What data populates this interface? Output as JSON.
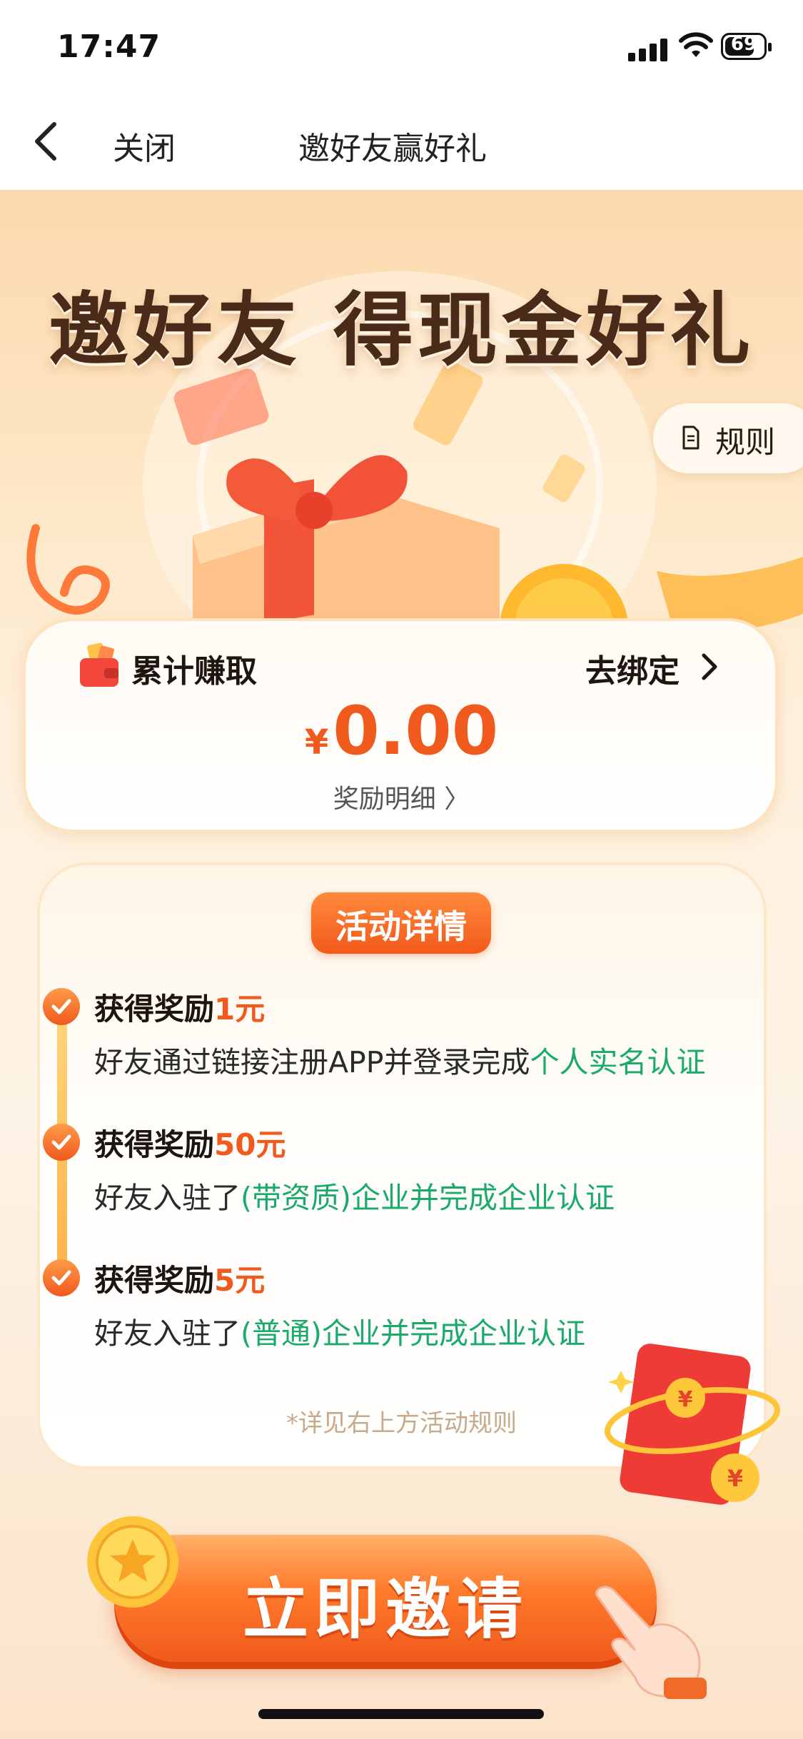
{
  "status_bar": {
    "time": "17:47",
    "battery": "69"
  },
  "nav": {
    "close_label": "关闭",
    "title": "邀好友赢好礼"
  },
  "hero": {
    "title": "邀好友 得现金好礼",
    "rules_label": "规则"
  },
  "earnings": {
    "label": "累计赚取",
    "bind_label": "去绑定",
    "currency": "¥",
    "amount": "0.00",
    "detail_label": "奖励明细 〉"
  },
  "activity": {
    "badge": "活动详情",
    "items": [
      {
        "title_prefix": "获得奖励",
        "amount": "1元",
        "desc_plain": "好友通过链接注册APP并登录完成",
        "desc_green": "个人实名认证",
        "desc_tail": ""
      },
      {
        "title_prefix": "获得奖励",
        "amount": "50元",
        "desc_plain": "好友入驻了",
        "desc_green": "(带资质)企业并完成企业认证",
        "desc_tail": ""
      },
      {
        "title_prefix": "获得奖励",
        "amount": "5元",
        "desc_plain": "好友入驻了",
        "desc_green": "(普通)企业并完成企业认证",
        "desc_tail": ""
      }
    ],
    "footnote": "*详见右上方活动规则"
  },
  "cta": {
    "label": "立即邀请"
  },
  "colors": {
    "accent": "#f05a1d",
    "green": "#1aaa6a",
    "title_brown": "#4a2a19"
  },
  "icons": [
    "back-chevron-icon",
    "document-icon",
    "wallet-icon",
    "chevron-right-icon",
    "check-icon",
    "star-coin-icon",
    "hand-pointer-icon",
    "red-envelope-icon"
  ]
}
